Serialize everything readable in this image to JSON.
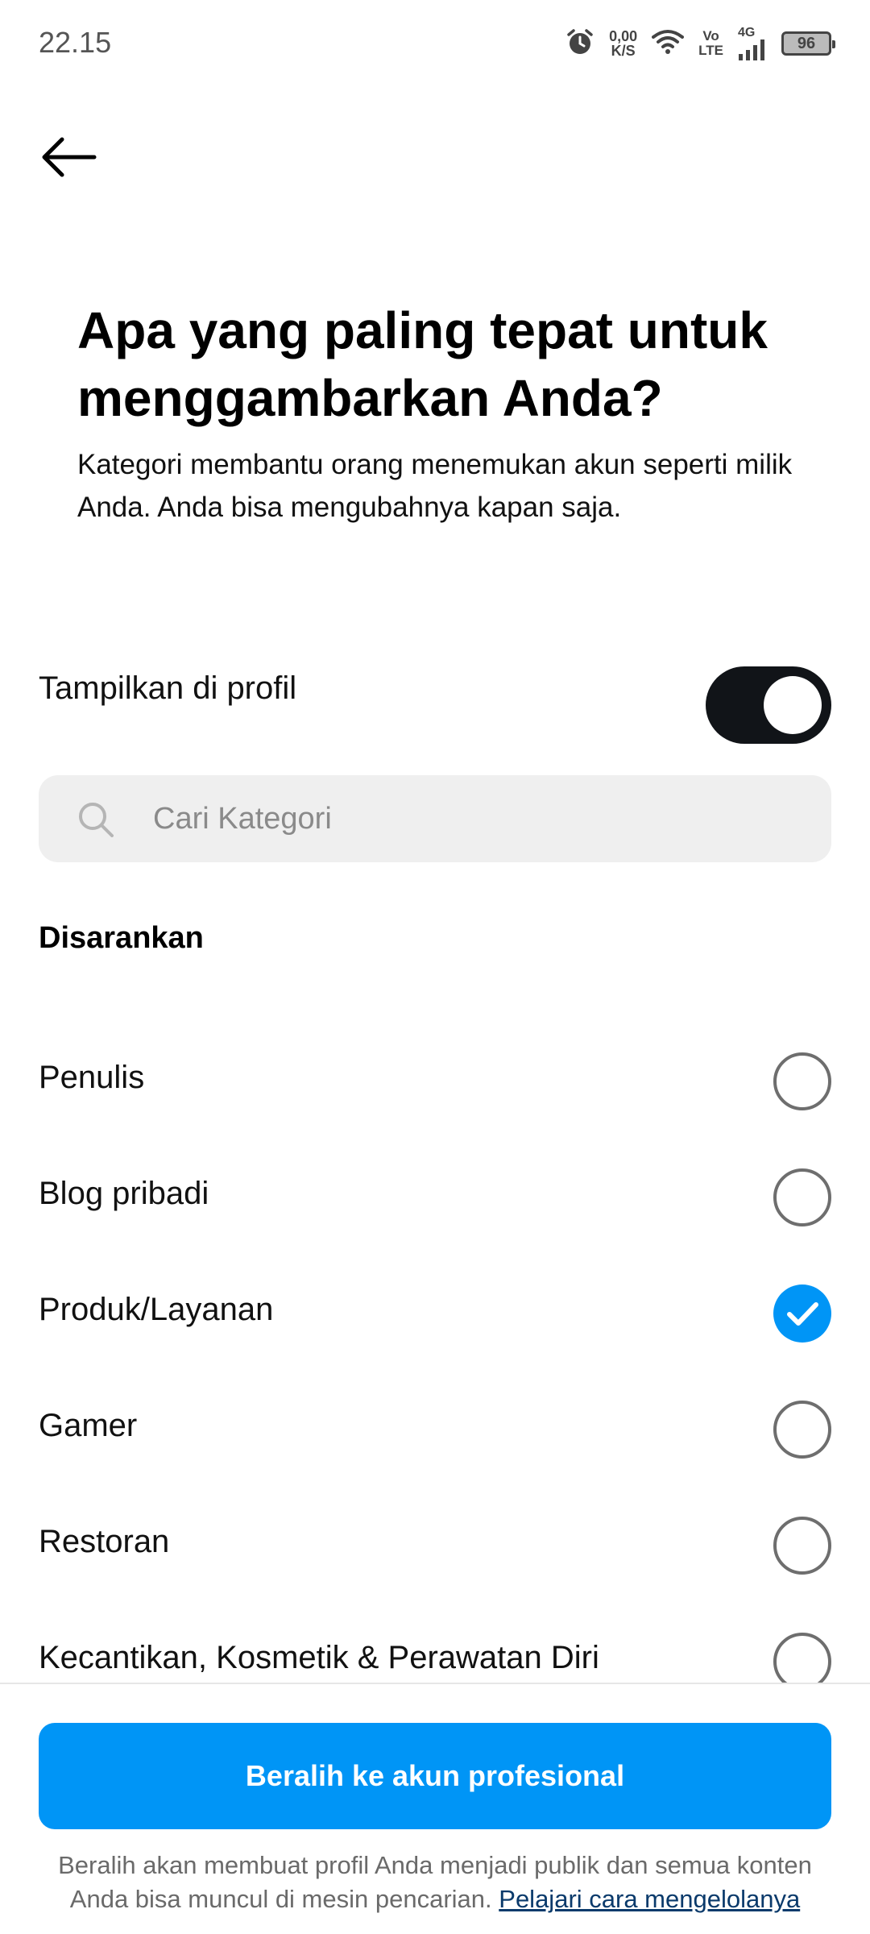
{
  "status_bar": {
    "time": "22.15",
    "net_speed_value": "0,00",
    "net_speed_unit": "K/S",
    "volte_top": "Vo",
    "volte_bottom": "LTE",
    "network_type": "4G",
    "battery_level": "96",
    "icons": [
      "alarm-icon",
      "wifi-icon",
      "signal-icon",
      "battery-icon"
    ]
  },
  "header": {
    "back_icon": "arrow-left-icon",
    "title": "Apa yang paling tepat untuk menggambarkan Anda?",
    "subtitle": "Kategori membantu orang menemukan akun seperti milik Anda. Anda bisa mengubahnya kapan saja."
  },
  "display_toggle": {
    "label": "Tampilkan di profil",
    "on": true
  },
  "search": {
    "placeholder": "Cari Kategori",
    "value": ""
  },
  "suggested": {
    "heading": "Disarankan",
    "items": [
      {
        "label": "Penulis",
        "selected": false
      },
      {
        "label": "Blog pribadi",
        "selected": false
      },
      {
        "label": "Produk/Layanan",
        "selected": true
      },
      {
        "label": "Gamer",
        "selected": false
      },
      {
        "label": "Restoran",
        "selected": false
      },
      {
        "label": "Kecantikan, Kosmetik & Perawatan Diri",
        "selected": false
      }
    ]
  },
  "footer": {
    "button_label": "Beralih ke akun profesional",
    "note_line1": "Beralih akan membuat profil Anda menjadi publik dan semua konten",
    "note_line2": "Anda bisa muncul di mesin pencarian.",
    "link_label": "Pelajari cara mengelolanya"
  },
  "colors": {
    "accent": "#0095f6",
    "toggle_on": "#111418",
    "search_bg": "#efefef",
    "link": "#0a3a6b"
  }
}
